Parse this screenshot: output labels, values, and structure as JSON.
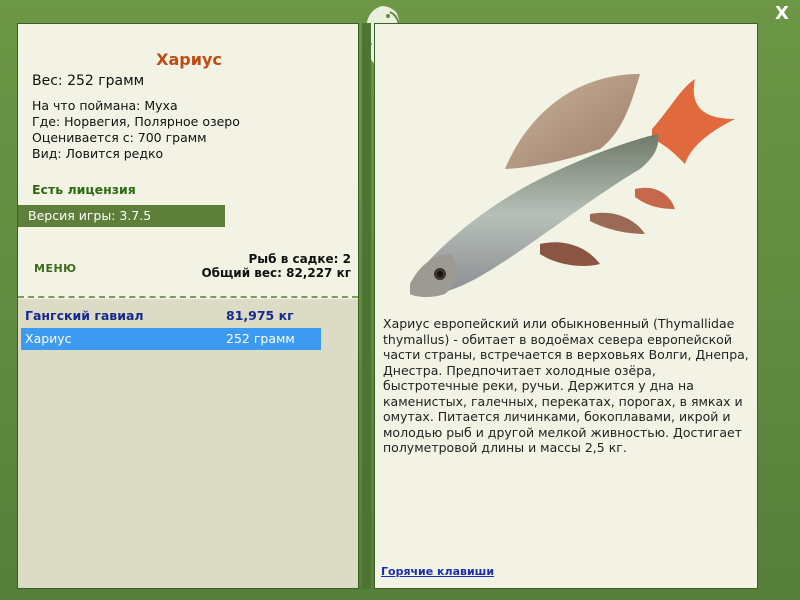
{
  "window": {
    "close_label": "X"
  },
  "fish": {
    "name": "Хариус",
    "weight_line": "Вес: 252 грамм",
    "caught_with": "На что поймана: Муха",
    "location": "Где: Норвегия, Полярное озеро",
    "value": "Оценивается с: 700 грамм",
    "rarity": "Вид: Ловится редко"
  },
  "license": "Есть лицензия",
  "version": "Версия игры: 3.7.5",
  "menu_label": "МЕНЮ",
  "stats": {
    "fish_in_keepnet": "Рыб в садке: 2",
    "total_weight": "Общий вес: 82,227 кг"
  },
  "catch_list": [
    {
      "name": "Гангский гавиал",
      "weight": "81,975 кг"
    },
    {
      "name": "Хариус",
      "weight": "252 грамм"
    }
  ],
  "description": "Хариус европейский или обыкновенный (Thymallidae thymallus) - обитает в водоёмах севера европейской части страны, встречается в верховьях Волги, Днепра, Днестра. Предпочитает холодные озёра, быстротечные реки, ручьи. Держится у дна на каменистых, галечных, перекатах, порогах, в ямках и омутах. Питается личинками, бокоплавами, икрой и молодью рыб и другой мелкой живностью. Достигает полуметровой длины и массы 2,5 кг.",
  "hotkeys_link": "Горячие клавиши",
  "colors": {
    "frame": "#5f8a3e",
    "panel": "#f3f3e5",
    "title": "#c04a10",
    "selection": "#3c9bf0"
  },
  "icons": {
    "logo": "fish-logo-icon",
    "close": "close-icon"
  }
}
